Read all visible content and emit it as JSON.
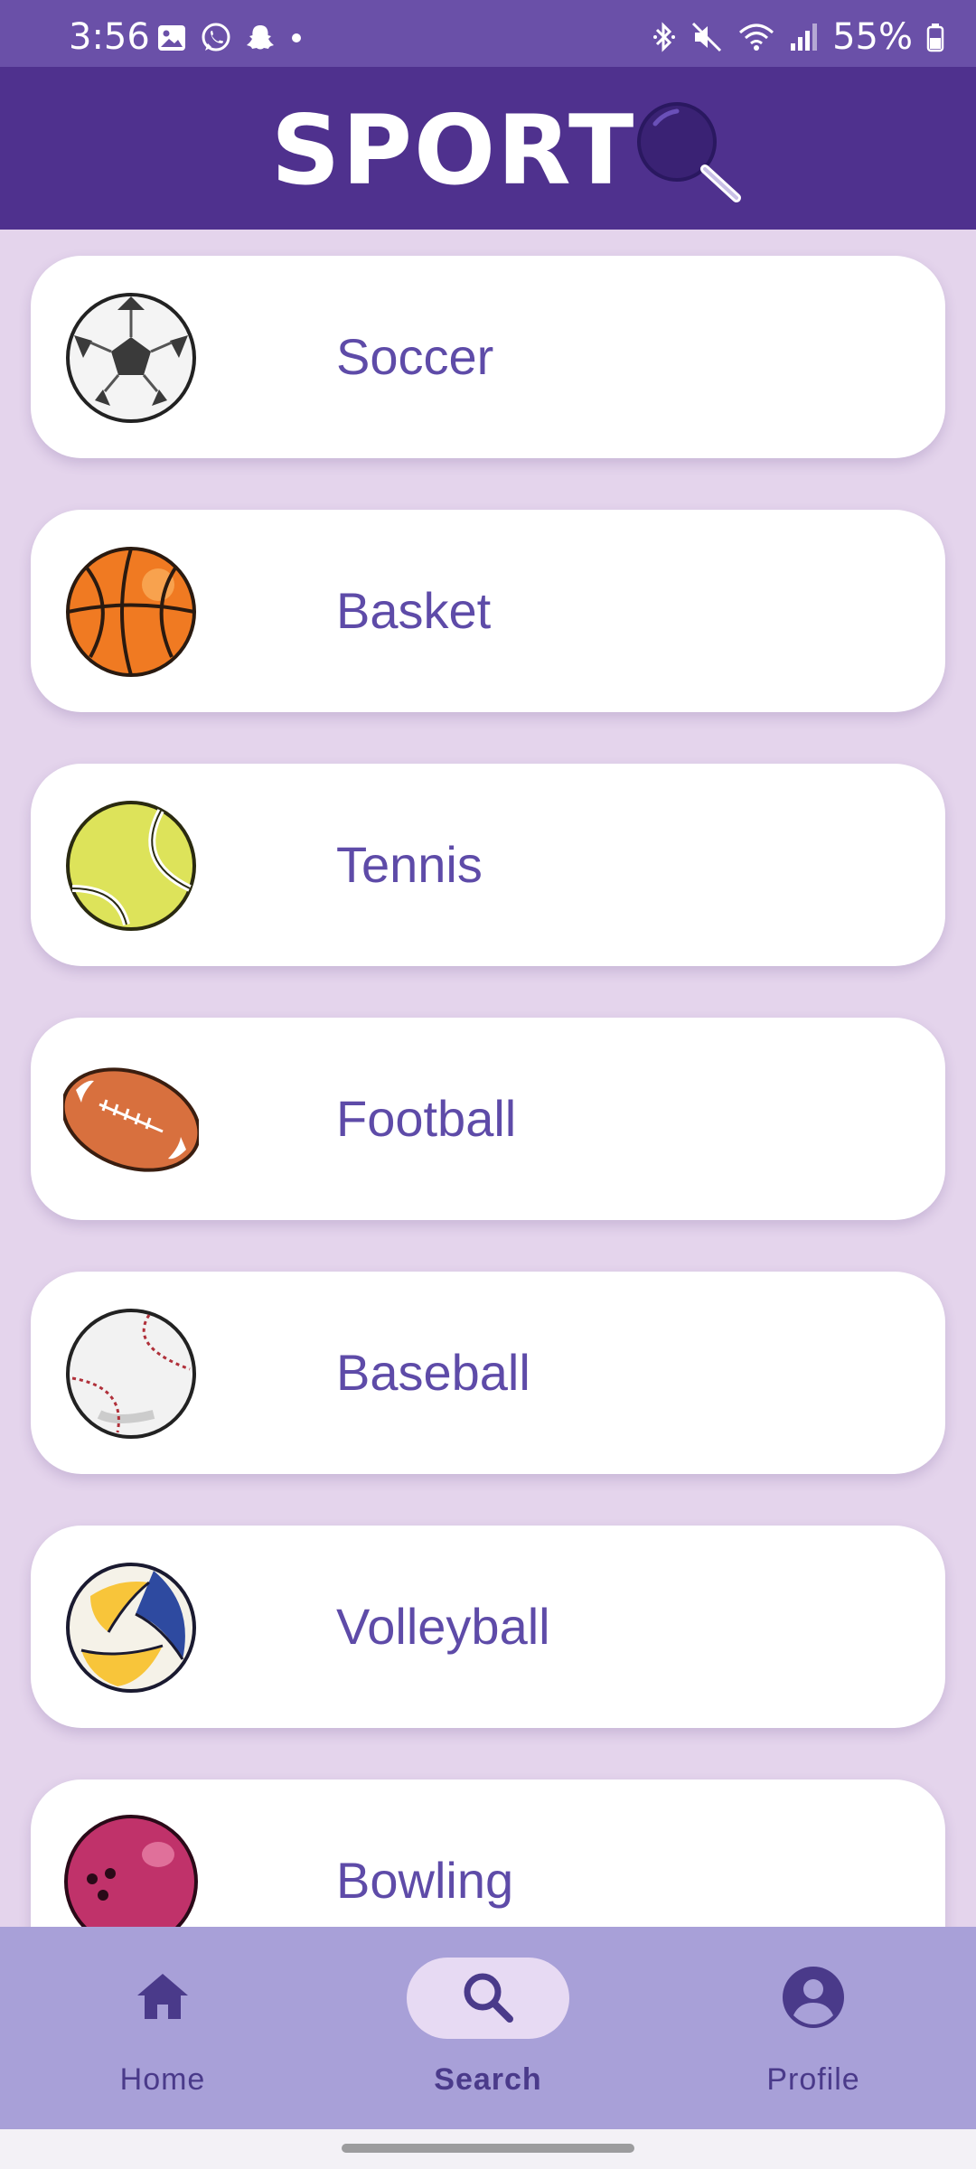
{
  "status_bar": {
    "time": "3:56",
    "battery": "55%",
    "left_icons": [
      "gallery-icon",
      "whatsapp-icon",
      "snapchat-icon",
      "dot-icon"
    ],
    "right_icons": [
      "bluetooth-icon",
      "mute-icon",
      "wifi-icon",
      "signal-icon",
      "battery-icon"
    ]
  },
  "header": {
    "logo_text": "SPORT",
    "logo_icon": "magnifier-icon"
  },
  "sports": [
    {
      "label": "Soccer",
      "icon": "soccer-ball-icon"
    },
    {
      "label": "Basket",
      "icon": "basketball-icon"
    },
    {
      "label": "Tennis",
      "icon": "tennis-ball-icon"
    },
    {
      "label": "Football",
      "icon": "football-icon"
    },
    {
      "label": "Baseball",
      "icon": "baseball-icon"
    },
    {
      "label": "Volleyball",
      "icon": "volleyball-icon"
    },
    {
      "label": "Bowling",
      "icon": "bowling-ball-icon"
    }
  ],
  "nav": {
    "home": "Home",
    "search": "Search",
    "profile": "Profile",
    "active": "search"
  },
  "colors": {
    "status_bar": "#6A50A8",
    "header": "#4F318E",
    "background": "#E4D4EC",
    "card_text": "#5E4BA8",
    "nav_bg": "#A8A0D8",
    "nav_active_pill": "#E7DAF3"
  }
}
